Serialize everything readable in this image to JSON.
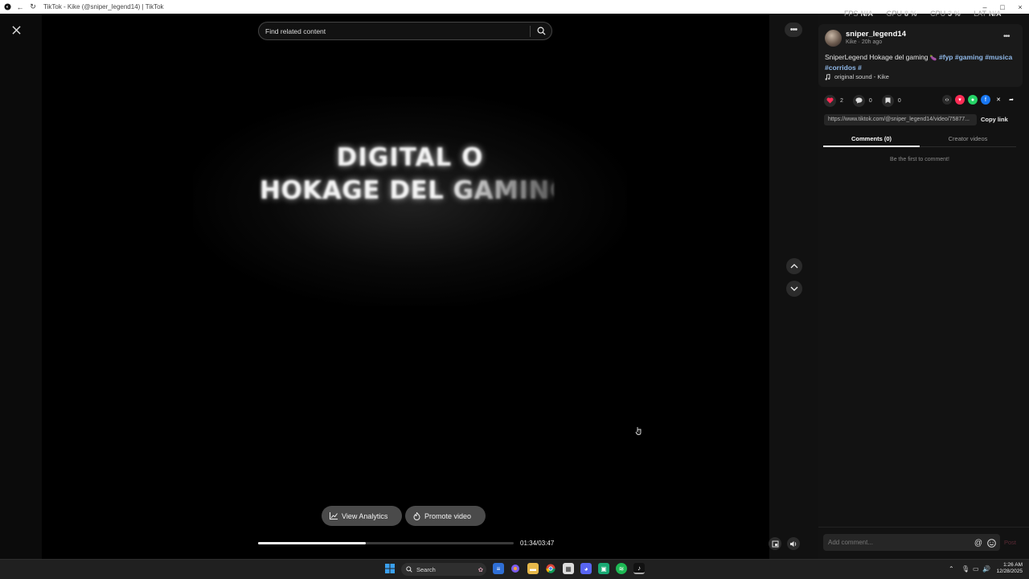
{
  "window": {
    "title": "TikTok - Kike (@sniper_legend14) | TikTok",
    "controls": [
      "–",
      "□",
      "×"
    ]
  },
  "search": {
    "placeholder": "Find related content"
  },
  "video": {
    "overlay_line1": "DIGITAL O",
    "overlay_line2": "HOKAGE DEL GAMING",
    "progress_fraction": 0.42,
    "time": "01:34/03:47"
  },
  "buttons": {
    "view_analytics": "View Analytics",
    "promote_video": "Promote video"
  },
  "stats": [
    {
      "label": "FPS",
      "value": "N/A"
    },
    {
      "label": "GPU",
      "value": "8 %"
    },
    {
      "label": "CPU",
      "value": "3 %"
    },
    {
      "label": "LAT",
      "value": "N/A"
    }
  ],
  "author": {
    "username": "sniper_legend14",
    "subline": "Kike · 20h ago"
  },
  "caption": {
    "text": "SniperLegend Hokage del gaming",
    "emoji": "🍆",
    "tags": [
      "#fyp",
      "#gaming",
      "#musica",
      "#corridos",
      "#"
    ]
  },
  "sound": {
    "label": "original sound - Kike"
  },
  "actions": {
    "likes": "2",
    "comments": "0",
    "saves": "0"
  },
  "share": {
    "link": "https://www.tiktok.com/@sniper_legend14/video/75877...",
    "copy_label": "Copy link"
  },
  "tabs": {
    "comments": "Comments (0)",
    "creator_videos": "Creator videos"
  },
  "comments": {
    "empty_message": "Be the first to comment!",
    "input_placeholder": "Add comment...",
    "post_label": "Post"
  },
  "taskbar": {
    "search_label": "Search",
    "clock_time": "1:26 AM",
    "clock_date": "12/28/2025"
  },
  "colors": {
    "like": "#fe2c55",
    "hashtag": "#8fb8e8",
    "panel_bg": "#121212"
  }
}
